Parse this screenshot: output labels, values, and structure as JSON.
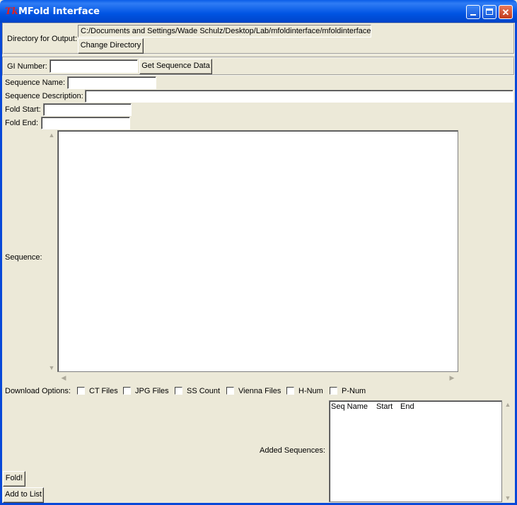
{
  "window": {
    "title": "MFold Interface",
    "app_icon": "Tk"
  },
  "output": {
    "label": "Directory for Output:",
    "path": "C:/Documents and Settings/Wade Schulz/Desktop/Lab/mfoldinterface/mfoldinterface",
    "change_button": "Change Directory"
  },
  "gi": {
    "label": "GI Number:",
    "value": "",
    "get_button": "Get Sequence Data"
  },
  "form": {
    "name_label": "Sequence Name:",
    "desc_label": "Sequence Description:",
    "start_label": "Fold Start:",
    "end_label": "Fold End:",
    "sequence_label": "Sequence:",
    "name_value": "",
    "desc_value": "",
    "start_value": "",
    "end_value": "",
    "sequence_value": ""
  },
  "download": {
    "label": "Download Options:",
    "options": [
      {
        "label": "CT Files",
        "checked": false
      },
      {
        "label": "JPG Files",
        "checked": false
      },
      {
        "label": "SS Count",
        "checked": false
      },
      {
        "label": "Vienna Files",
        "checked": false
      },
      {
        "label": "H-Num",
        "checked": false
      },
      {
        "label": "P-Num",
        "checked": false
      }
    ]
  },
  "added": {
    "label": "Added Sequences:",
    "columns": [
      "Seq Name",
      "Start",
      "End"
    ]
  },
  "buttons": {
    "fold": "Fold!",
    "add": "Add to List"
  }
}
